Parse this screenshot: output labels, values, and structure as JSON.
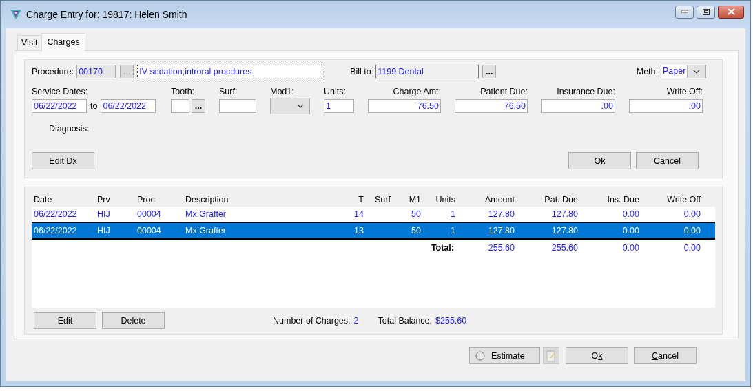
{
  "window": {
    "title": "Charge Entry for: 19817: Helen Smith"
  },
  "tabs": [
    {
      "label": "Visit",
      "selected": false
    },
    {
      "label": "Charges",
      "selected": true
    }
  ],
  "procedure": {
    "label": "Procedure:",
    "code": "00170",
    "browse": "...",
    "description": "IV sedation;introral procdures"
  },
  "bill_to": {
    "label": "Bill to:",
    "value": "1199 Dental",
    "browse": "..."
  },
  "method": {
    "label": "Meth:",
    "value": "Paper"
  },
  "entry_fields": [
    {
      "kind": "dates",
      "label": "Service Dates:",
      "from": "06/22/2022",
      "separator": "to",
      "to": "06/22/2022"
    },
    {
      "kind": "picker",
      "label": "Tooth:",
      "browse": "..."
    },
    {
      "kind": "text",
      "label": "Surf:"
    },
    {
      "kind": "dropdown",
      "label": "Mod1:"
    },
    {
      "kind": "text",
      "label": "Units:",
      "value": "1"
    },
    {
      "kind": "amount",
      "label": "Charge Amt:",
      "value": "76.50"
    },
    {
      "kind": "amount",
      "label": "Patient Due:",
      "value": "76.50"
    },
    {
      "kind": "amount",
      "label": "Insurance Due:",
      "value": ".00"
    },
    {
      "kind": "amount",
      "label": "Write Off:",
      "value": ".00"
    }
  ],
  "diagnosis": {
    "label": "Diagnosis:"
  },
  "entry_buttons": [
    {
      "label": "Edit Dx"
    },
    {
      "label": "Ok"
    },
    {
      "label": "Cancel"
    }
  ],
  "table": {
    "columns": [
      "Date",
      "Prv",
      "Proc",
      "Description",
      "T",
      "Surf",
      "M1",
      "Units",
      "Amount",
      "Pat. Due",
      "Ins. Due",
      "Write Off"
    ],
    "rows": [
      {
        "selected": false,
        "cells": [
          "06/22/2022",
          "HIJ",
          "00004",
          "Mx Grafter",
          "14",
          "",
          "50",
          "1",
          "127.80",
          "127.80",
          "0.00",
          "0.00"
        ]
      },
      {
        "selected": true,
        "cells": [
          "06/22/2022",
          "HIJ",
          "00004",
          "Mx Grafter",
          "13",
          "",
          "50",
          "1",
          "127.80",
          "127.80",
          "0.00",
          "0.00"
        ]
      }
    ],
    "total": {
      "label": "Total:",
      "values": [
        "255.60",
        "255.60",
        "0.00",
        "0.00"
      ]
    }
  },
  "list_buttons": [
    {
      "label": "Edit"
    },
    {
      "label": "Delete"
    }
  ],
  "summary": [
    {
      "label": "Number of Charges:",
      "value": "2"
    },
    {
      "label": "Total Balance:",
      "value": "$255.60"
    }
  ],
  "estimate": {
    "label": "Estimate",
    "checked": false
  },
  "dialog_buttons": [
    {
      "before": "O",
      "access_key": "k"
    },
    {
      "access_key": "C",
      "after": "ancel"
    }
  ]
}
